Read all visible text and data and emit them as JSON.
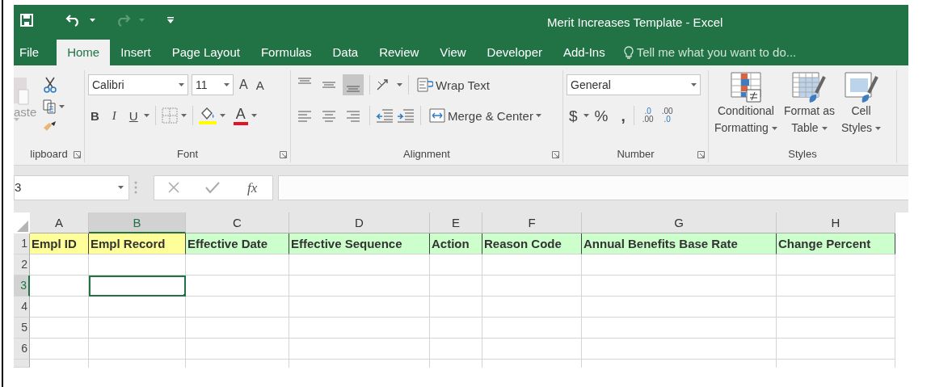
{
  "quick_access": [
    {
      "kind": "save",
      "disabled": false
    },
    {
      "kind": "undo",
      "disabled": false
    },
    {
      "kind": "dropdown",
      "disabled": false
    },
    {
      "kind": "redo",
      "disabled": true
    },
    {
      "kind": "dropdown",
      "disabled": true
    },
    {
      "kind": "customize",
      "disabled": false
    }
  ],
  "window": {
    "title": "Merit Increases Template - Excel"
  },
  "tabs": [
    {
      "label": "File",
      "selected": false
    },
    {
      "label": "Home",
      "selected": true
    },
    {
      "label": "Insert",
      "selected": false
    },
    {
      "label": "Page Layout",
      "selected": false
    },
    {
      "label": "Formulas",
      "selected": false
    },
    {
      "label": "Data",
      "selected": false
    },
    {
      "label": "Review",
      "selected": false
    },
    {
      "label": "View",
      "selected": false
    },
    {
      "label": "Developer",
      "selected": false
    },
    {
      "label": "Add-Ins",
      "selected": false
    }
  ],
  "tell_me": {
    "placeholder": "Tell me what you want to do..."
  },
  "clipboard": {
    "paste_label": "aste",
    "label": "lipboard"
  },
  "font": {
    "name": "Calibri",
    "size": "11",
    "grow": "A",
    "shrink": "A",
    "bold": "B",
    "italic": "I",
    "underline": "U",
    "font_color": "A",
    "label": "Font"
  },
  "alignment": {
    "vertical": [
      {
        "kind": "top",
        "selected": false
      },
      {
        "kind": "middle",
        "selected": false
      },
      {
        "kind": "bottom",
        "selected": true
      }
    ],
    "horizontal": [
      {
        "kind": "left",
        "selected": false
      },
      {
        "kind": "center",
        "selected": false
      },
      {
        "kind": "right",
        "selected": false
      }
    ],
    "wrap_text": "Wrap Text",
    "merge_center": "Merge & Center",
    "label": "Alignment"
  },
  "number": {
    "format": "General",
    "currency": "$",
    "percent": "%",
    "comma": ",",
    "increase_decimal": [
      ".0",
      ".00"
    ],
    "decrease_decimal": [
      ".00",
      ".0"
    ],
    "label": "Number"
  },
  "styles": {
    "buttons": [
      {
        "kind": "conditional",
        "lines": [
          "Conditional",
          "Formatting"
        ]
      },
      {
        "kind": "table",
        "lines": [
          "Format as",
          "Table"
        ]
      },
      {
        "kind": "cell",
        "lines": [
          "Cell",
          "Styles"
        ]
      }
    ],
    "label": "Styles"
  },
  "formula_bar": {
    "name_box": "3",
    "function_label": "fx"
  },
  "sheet": {
    "columns": [
      {
        "letter": "A",
        "selected": false
      },
      {
        "letter": "B",
        "selected": true
      },
      {
        "letter": "C",
        "selected": false
      },
      {
        "letter": "D",
        "selected": false
      },
      {
        "letter": "E",
        "selected": false
      },
      {
        "letter": "F",
        "selected": false
      },
      {
        "letter": "G",
        "selected": false
      },
      {
        "letter": "H",
        "selected": false
      }
    ],
    "header_row": [
      {
        "text": "Empl ID",
        "color": "#ffff99"
      },
      {
        "text": "Empl Record",
        "color": "#ffff99"
      },
      {
        "text": "Effective Date",
        "color": "#ccffcc"
      },
      {
        "text": "Effective Sequence",
        "color": "#ccffcc"
      },
      {
        "text": "Action",
        "color": "#ccffcc"
      },
      {
        "text": "Reason Code",
        "color": "#ccffcc"
      },
      {
        "text": "Annual Benefits Base Rate",
        "color": "#ccffcc"
      },
      {
        "text": "Change Percent",
        "color": "#ccffcc"
      }
    ],
    "rows": [
      {
        "number": "1",
        "selected": false
      },
      {
        "number": "2",
        "selected": false
      },
      {
        "number": "3",
        "selected": true
      },
      {
        "number": "4",
        "selected": false
      },
      {
        "number": "5",
        "selected": false
      },
      {
        "number": "6",
        "selected": false
      }
    ]
  }
}
